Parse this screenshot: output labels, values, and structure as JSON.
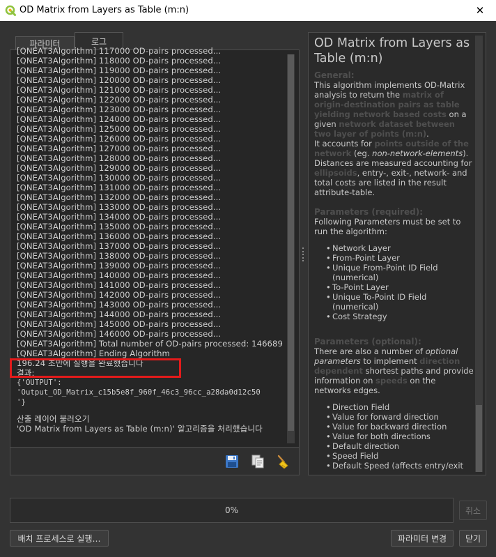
{
  "window": {
    "title": "OD Matrix from Layers as Table (m:n)",
    "close_label": "✕"
  },
  "tabs": [
    {
      "label": "파라미터",
      "active": false
    },
    {
      "label": "로그",
      "active": true
    }
  ],
  "log": {
    "lines": [
      "[QNEAT3Algorithm] 117000 OD-pairs processed...",
      "[QNEAT3Algorithm] 118000 OD-pairs processed...",
      "[QNEAT3Algorithm] 119000 OD-pairs processed...",
      "[QNEAT3Algorithm] 120000 OD-pairs processed...",
      "[QNEAT3Algorithm] 121000 OD-pairs processed...",
      "[QNEAT3Algorithm] 122000 OD-pairs processed...",
      "[QNEAT3Algorithm] 123000 OD-pairs processed...",
      "[QNEAT3Algorithm] 124000 OD-pairs processed...",
      "[QNEAT3Algorithm] 125000 OD-pairs processed...",
      "[QNEAT3Algorithm] 126000 OD-pairs processed...",
      "[QNEAT3Algorithm] 127000 OD-pairs processed...",
      "[QNEAT3Algorithm] 128000 OD-pairs processed...",
      "[QNEAT3Algorithm] 129000 OD-pairs processed...",
      "[QNEAT3Algorithm] 130000 OD-pairs processed...",
      "[QNEAT3Algorithm] 131000 OD-pairs processed...",
      "[QNEAT3Algorithm] 132000 OD-pairs processed...",
      "[QNEAT3Algorithm] 133000 OD-pairs processed...",
      "[QNEAT3Algorithm] 134000 OD-pairs processed...",
      "[QNEAT3Algorithm] 135000 OD-pairs processed...",
      "[QNEAT3Algorithm] 136000 OD-pairs processed...",
      "[QNEAT3Algorithm] 137000 OD-pairs processed...",
      "[QNEAT3Algorithm] 138000 OD-pairs processed...",
      "[QNEAT3Algorithm] 139000 OD-pairs processed...",
      "[QNEAT3Algorithm] 140000 OD-pairs processed...",
      "[QNEAT3Algorithm] 141000 OD-pairs processed...",
      "[QNEAT3Algorithm] 142000 OD-pairs processed...",
      "[QNEAT3Algorithm] 143000 OD-pairs processed...",
      "[QNEAT3Algorithm] 144000 OD-pairs processed...",
      "[QNEAT3Algorithm] 145000 OD-pairs processed...",
      "[QNEAT3Algorithm] 146000 OD-pairs processed...",
      "[QNEAT3Algorithm] Total number of OD-pairs processed: 146689",
      "[QNEAT3Algorithm] Ending Algorithm",
      "196.24 초만에 실행을 완료했습니다",
      "결과:",
      "{'OUTPUT':",
      "'Output_OD_Matrix_c15b5e8f_960f_46c3_96cc_a28da0d12c50",
      "'}",
      "",
      "산출 레이어 불러오기",
      "'OD Matrix from Layers as Table (m:n)' 알고리즘을 처리했습니다"
    ]
  },
  "toolbar": {
    "save_icon": "save-icon",
    "copy_icon": "copy-icon",
    "clear_icon": "clear-broom-icon"
  },
  "help": {
    "title": "OD Matrix from Layers as Table (m:n)",
    "general_head": "General:",
    "p1_a": "This algorithm implements OD-Matrix analysis to return the ",
    "p1_b": "matrix of origin-destination pairs as table yielding network based costs",
    "p1_c": " on a given ",
    "p1_d": "network dataset between two layer of points (m:n)",
    "p1_e": ".",
    "p2_a": "It accounts for ",
    "p2_b": "points outside of the network",
    "p2_c": " (eg. ",
    "p2_d": "non-network-elements",
    "p2_e": "). Distances are measured accounting for ",
    "p2_f": "ellipsoids",
    "p2_g": ", entry-, exit-, network- and total costs are listed in the result attribute-table.",
    "req_head": "Parameters (required):",
    "req_intro": "Following Parameters must be set to run the algorithm:",
    "req_items": [
      "Network Layer",
      "From-Point Layer",
      "Unique From-Point ID Field (numerical)",
      "To-Point Layer",
      "Unique To-Point ID Field (numerical)",
      "Cost Strategy"
    ],
    "opt_head": "Parameters (optional):",
    "opt_a": "There are also a number of ",
    "opt_b": "optional parameters",
    "opt_c": " to implement ",
    "opt_d": "direction dependent",
    "opt_e": " shortest paths and provide information on ",
    "opt_f": "speeds",
    "opt_g": " on the networks edges.",
    "opt_items": [
      "Direction Field",
      "Value for forward direction",
      "Value for backward direction",
      "Value for both directions",
      "Default direction",
      "Speed Field",
      "Default Speed (affects entry/exit costs)"
    ]
  },
  "progress": {
    "label": "0%",
    "value": 0
  },
  "buttons": {
    "cancel": "취소",
    "batch": "배치 프로세스로 실행…",
    "change_params": "파라미터 변경",
    "close": "닫기"
  },
  "colors": {
    "highlight": "#e21b1b",
    "background": "#333333"
  }
}
